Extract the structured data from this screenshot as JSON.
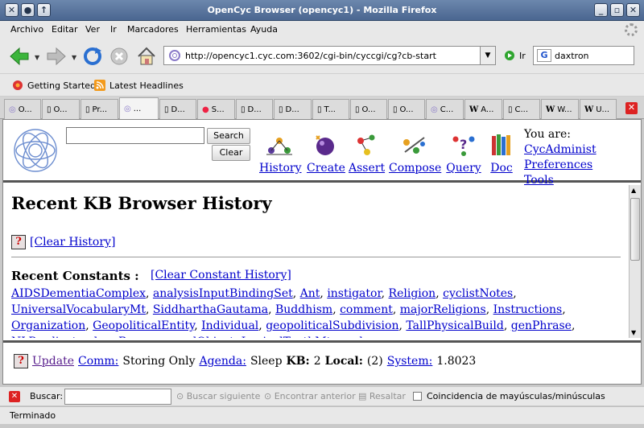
{
  "window": {
    "title": "OpenCyc Browser (opencyc1) - Mozilla Firefox"
  },
  "menu": [
    "Archivo",
    "Editar",
    "Ver",
    "Ir",
    "Marcadores",
    "Herramientas",
    "Ayuda"
  ],
  "nav": {
    "url": "http://opencyc1.cyc.com:3602/cgi-bin/cyccgi/cg?cb-start",
    "go_label": "Ir",
    "search_value": "daxtron"
  },
  "bookmarks": [
    "Getting Started",
    "Latest Headlines"
  ],
  "tabs": [
    "O...",
    "O...",
    "Pr...",
    "...",
    "D...",
    "S...",
    "D...",
    "D...",
    "T...",
    "O...",
    "O...",
    "C...",
    "A...",
    "C...",
    "W...",
    "U..."
  ],
  "cyc": {
    "search_button": "Search",
    "clear_button": "Clear",
    "tools": [
      "History",
      "Create",
      "Assert",
      "Compose",
      "Query",
      "Doc"
    ],
    "you_are_label": "You are:",
    "user": "CycAdminist",
    "preferences": "Preferences",
    "tools_link": "Tools"
  },
  "history": {
    "title": "Recent KB Browser History",
    "clear_history": "[Clear History]",
    "recent_constants_label": "Recent Constants :",
    "clear_constant_history": "[Clear Constant History]",
    "constants": [
      "AIDSDementiaComplex",
      "analysisInputBindingSet",
      "Ant",
      "instigator",
      "Religion",
      "cyclistNotes",
      "UniversalVocabularyMt",
      "SiddharthaGautama",
      "Buddhism",
      "comment",
      "majorReligions",
      "Instructions",
      "Organization",
      "GeopoliticalEntity",
      "Individual",
      "geopoliticalSubdivision",
      "TallPhysicalBuild",
      "genPhrase",
      "NLPredicate",
      "doneBy",
      "consumedObject",
      "LogicalTruthMt",
      "genls"
    ]
  },
  "status": {
    "update": "Update",
    "comm_label": "Comm:",
    "comm_value": "Storing Only",
    "agenda_label": "Agenda:",
    "agenda_value": "Sleep",
    "kb_label": "KB:",
    "kb_value": "2",
    "local_label": "Local:",
    "local_value": "(2)",
    "system_label": "System:",
    "system_value": "1.8023"
  },
  "findbar": {
    "label": "Buscar:",
    "next": "Buscar siguiente",
    "prev": "Encontrar anterior",
    "highlight": "Resaltar",
    "match_case": "Coincidencia de mayúsculas/minúsculas"
  },
  "statusbar": "Terminado",
  "colors": {
    "link": "#0000cc",
    "visited": "#551a8b",
    "titlebar": "#5a77a0"
  }
}
